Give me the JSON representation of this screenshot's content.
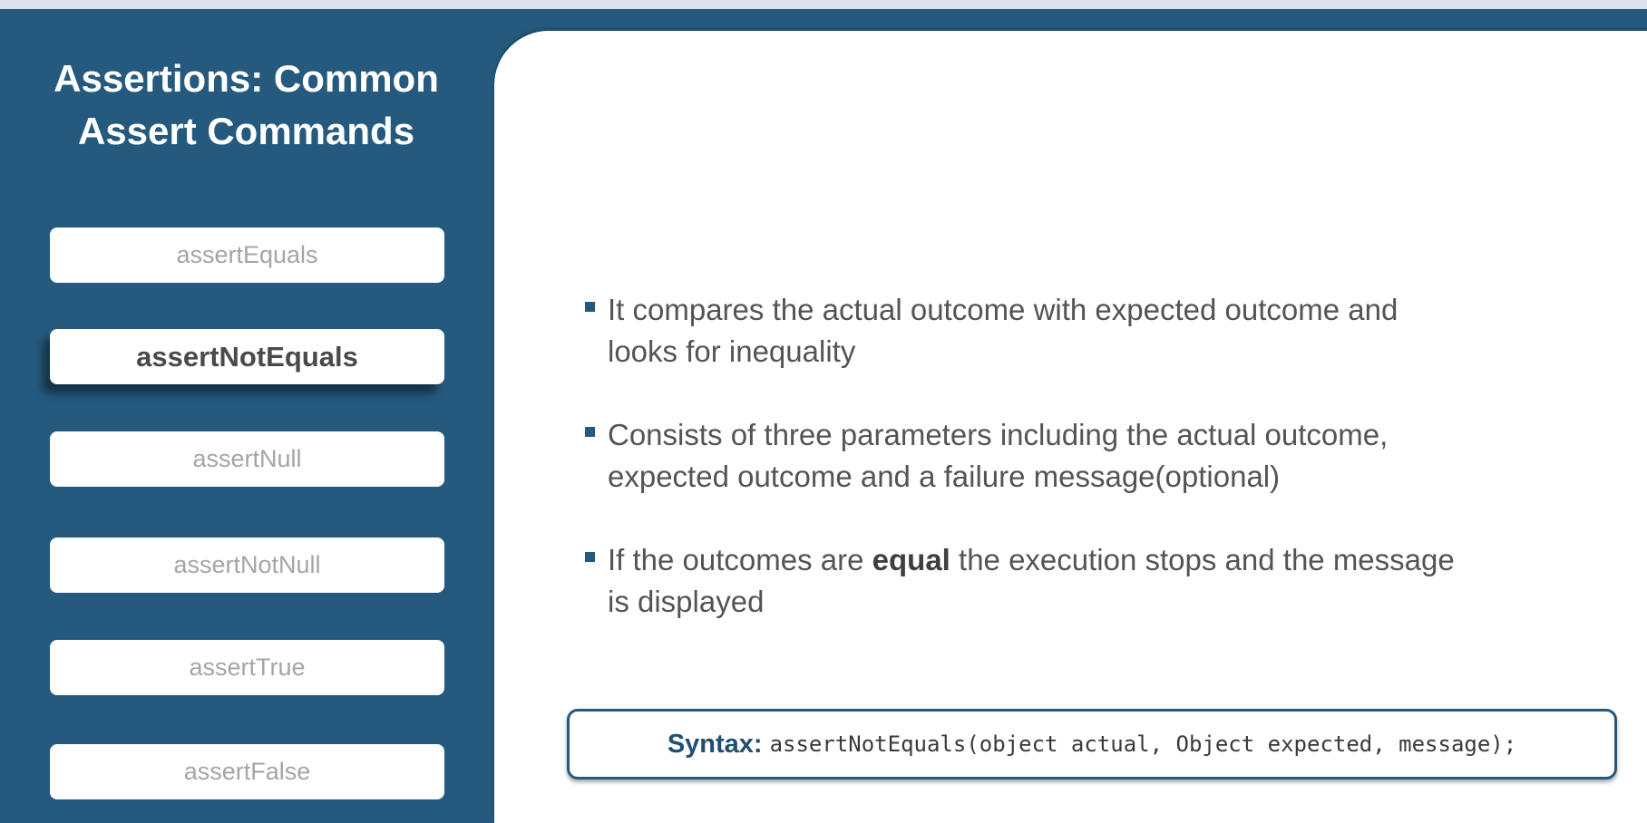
{
  "sidebar": {
    "title_line1": "Assertions: Common",
    "title_line2": "Assert Commands",
    "items": [
      {
        "label": "assertEquals",
        "active": false
      },
      {
        "label": "assertNotEquals",
        "active": true
      },
      {
        "label": "assertNull",
        "active": false
      },
      {
        "label": "assertNotNull",
        "active": false
      },
      {
        "label": "assertTrue",
        "active": false
      },
      {
        "label": "assertFalse",
        "active": false
      }
    ]
  },
  "content": {
    "bullets": [
      {
        "line1": "It compares the actual outcome with expected outcome and",
        "line2": "looks for inequality"
      },
      {
        "line1": "Consists of three parameters including the actual outcome,",
        "line2": "expected outcome and a failure message(optional)"
      },
      {
        "prefix": "If the outcomes are ",
        "emphasis": "equal",
        "suffix": " the execution stops and the message",
        "line2": "is displayed"
      }
    ],
    "syntax": {
      "label": "Syntax:",
      "code": "assertNotEquals(object actual, Object expected, message);"
    }
  },
  "colors": {
    "sidebar_bg": "#255a7e",
    "content_bg": "#ffffff",
    "accent": "#255a7e",
    "inactive_text": "#a5a5a5",
    "active_text": "#4a4a4a"
  }
}
